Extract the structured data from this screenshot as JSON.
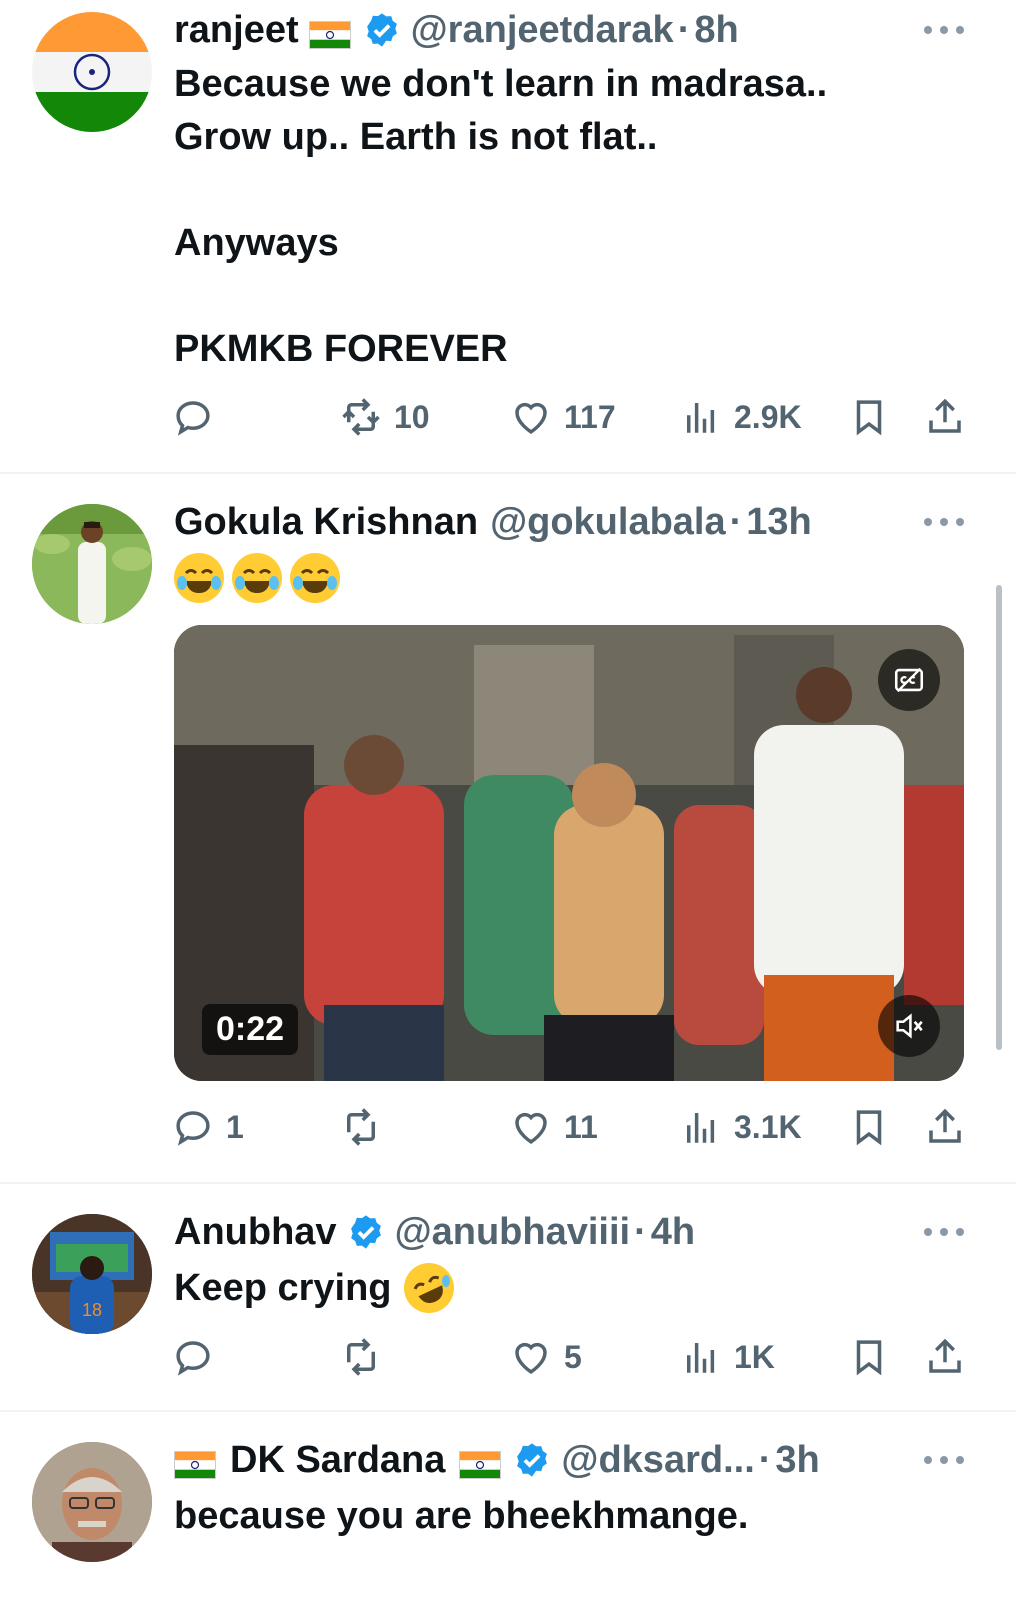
{
  "tweets": [
    {
      "name": "ranjeet",
      "handle": "@ranjeetdarak",
      "time": "8h",
      "text": "Because we don't learn in madrasa..\nGrow up.. Earth is not flat..\n\nAnyways\n\nPKMKB FOREVER",
      "stats": {
        "replies": "",
        "retweets": "10",
        "likes": "117",
        "views": "2.9K"
      }
    },
    {
      "name": "Gokula Krishnan",
      "handle": "@gokulabala",
      "time": "13h",
      "emoji_text": "😂😂😂",
      "video": {
        "duration": "0:22"
      },
      "stats": {
        "replies": "1",
        "retweets": "",
        "likes": "11",
        "views": "3.1K"
      }
    },
    {
      "name": "Anubhav",
      "handle": "@anubhaviiii",
      "time": "4h",
      "text": "Keep crying",
      "stats": {
        "replies": "",
        "retweets": "",
        "likes": "5",
        "views": "1K"
      }
    },
    {
      "name": "DK Sardana",
      "handle": "@dksard...",
      "time": "3h",
      "text": "because you are bheekhmange."
    }
  ],
  "separator": "·",
  "colors": {
    "verified": "#1d9bf0",
    "secondary_text": "#536471",
    "saffron": "#ff9933",
    "india_green": "#138808"
  },
  "icons": [
    "reply-icon",
    "retweet-icon",
    "like-icon",
    "views-icon",
    "bookmark-icon",
    "share-icon",
    "verified-badge-icon",
    "more-icon",
    "captions-icon",
    "mute-icon"
  ]
}
